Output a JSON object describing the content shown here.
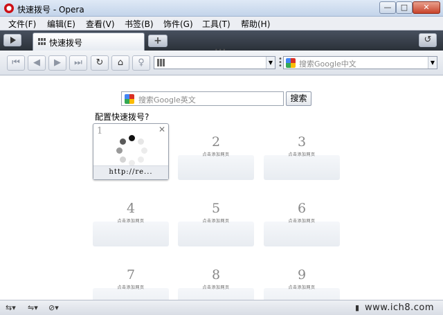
{
  "window": {
    "title": "快速拨号 - Opera",
    "min_label": "—",
    "max_label": "□",
    "close_label": "✕"
  },
  "menu": [
    {
      "label": "文件(F)"
    },
    {
      "label": "编辑(E)"
    },
    {
      "label": "查看(V)"
    },
    {
      "label": "书签(B)"
    },
    {
      "label": "饰件(G)"
    },
    {
      "label": "工具(T)"
    },
    {
      "label": "帮助(H)"
    }
  ],
  "tabs": {
    "active_label": "快速拨号",
    "new_tab_label": "+",
    "closed_tabs_label": "↺"
  },
  "toolbar": {
    "address_value": "",
    "search_placeholder": "搜索Google中文"
  },
  "speed_dial": {
    "search_placeholder": "搜索Google英文",
    "search_button": "搜索",
    "config_label": "配置快速拨号?",
    "dial1": {
      "number": "1",
      "url": "http://re..."
    },
    "add_hint": "点击添加网页",
    "dials": [
      {
        "number": "2"
      },
      {
        "number": "3"
      },
      {
        "number": "4"
      },
      {
        "number": "5"
      },
      {
        "number": "6"
      },
      {
        "number": "7"
      },
      {
        "number": "8"
      },
      {
        "number": "9"
      }
    ]
  },
  "statusbar": {
    "watermark": "www.ich8.com"
  },
  "colors": {
    "tabbar": "#2b3139",
    "opera_red": "#cc0f16"
  }
}
